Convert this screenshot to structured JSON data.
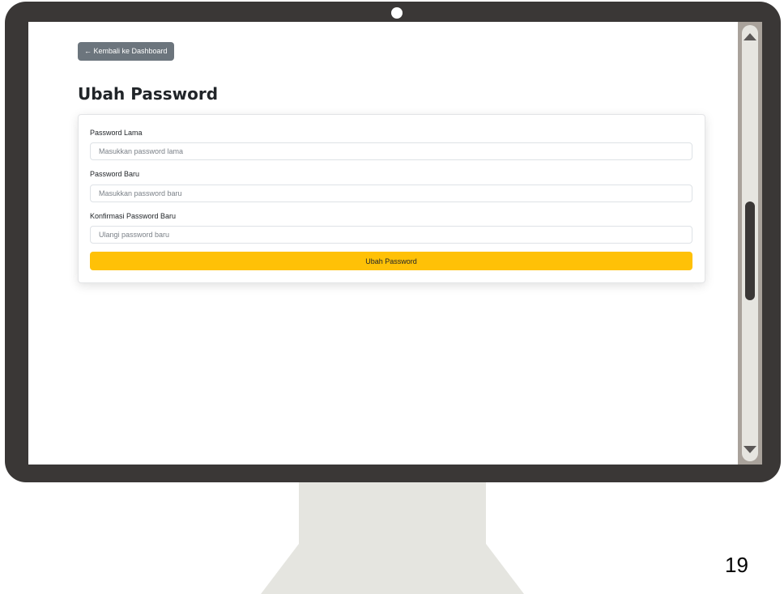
{
  "app": {
    "back_button_label": "← Kembali ke Dashboard",
    "page_title": "Ubah Password"
  },
  "form": {
    "old_password": {
      "label": "Password Lama",
      "placeholder": "Masukkan password lama",
      "value": ""
    },
    "new_password": {
      "label": "Password Baru",
      "placeholder": "Masukkan password baru",
      "value": ""
    },
    "confirm_password": {
      "label": "Konfirmasi Password Baru",
      "placeholder": "Ulangi password baru",
      "value": ""
    },
    "submit_label": "Ubah Password"
  },
  "slide": {
    "page_number": "19"
  },
  "colors": {
    "back_button": "#6c757d",
    "submit_button": "#ffc107",
    "monitor_frame": "#3a3736",
    "stand": "#e5e5e0"
  },
  "icons": {
    "camera": "camera-dot-icon",
    "scroll_up": "scroll-up-arrow-icon",
    "scroll_down": "scroll-down-arrow-icon"
  }
}
